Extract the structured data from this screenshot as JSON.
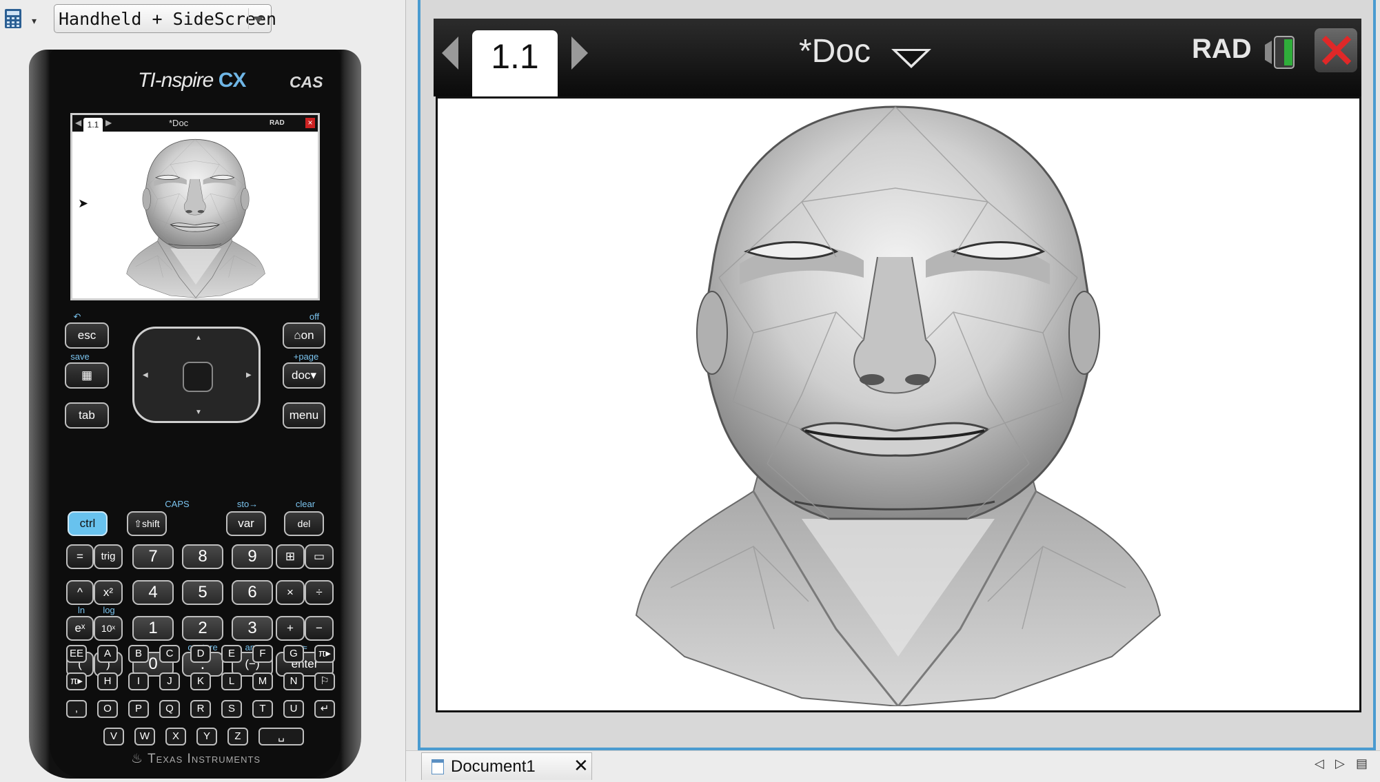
{
  "toolbar": {
    "view_mode": "Handheld + SideScreen",
    "calculator_icon": "calculator-icon",
    "dropdown_icon": "chevron-down-icon"
  },
  "handheld": {
    "brand_ti": "TI-",
    "brand_nspire": "nspire",
    "brand_cx": " CX",
    "brand_cas": "CAS",
    "maker": "Texas Instruments",
    "mini_screen": {
      "tab": "1.1",
      "doc": "*Doc",
      "rad": "RAD"
    },
    "keys": {
      "esc": "esc",
      "on": "on",
      "doc": "doc",
      "tab": "tab",
      "menu": "menu",
      "ctrl": "ctrl",
      "shift": "shift",
      "var": "var",
      "del": "del",
      "equals": "=",
      "trig": "trig",
      "n7": "7",
      "n8": "8",
      "n9": "9",
      "caret": "^",
      "x2": "x²",
      "n4": "4",
      "n5": "5",
      "n6": "6",
      "times": "×",
      "divide": "÷",
      "ex": "eˣ",
      "tenx": "10ˣ",
      "n1": "1",
      "n2": "2",
      "n3": "3",
      "plus": "+",
      "minus": "−",
      "lparen": "(",
      "rparen": ")",
      "n0": "0",
      "dot": ".",
      "neg": "(−)",
      "enter": "enter",
      "ee": "EE",
      "comma": ",",
      "pi": "π▸",
      "flag": "⚐",
      "return": "↵",
      "space": "␣",
      "letters": [
        "A",
        "B",
        "C",
        "D",
        "E",
        "F",
        "G",
        "H",
        "I",
        "J",
        "K",
        "L",
        "M",
        "N",
        "O",
        "P",
        "Q",
        "R",
        "S",
        "T",
        "U",
        "V",
        "W",
        "X",
        "Y",
        "Z"
      ]
    },
    "shift_labels": {
      "undo": "↶",
      "off": "off",
      "save": "save",
      "page": "+page",
      "caps": "CAPS",
      "sto": "sto→",
      "clear": "clear",
      "ln": "ln",
      "log": "log",
      "capture": "capture",
      "ans": "ans",
      "approx": "≈"
    }
  },
  "screen": {
    "page_tab": "1.1",
    "doc_title": "*Doc",
    "angle_mode": "RAD",
    "battery_icon": "battery-icon",
    "close_icon": "close-icon",
    "graph": "3d-face-mesh"
  },
  "doc_tabs": {
    "items": [
      {
        "label": "Document1"
      }
    ],
    "close_glyph": "✕",
    "scroll_left": "◁",
    "scroll_right": "▷",
    "list": "▤"
  }
}
